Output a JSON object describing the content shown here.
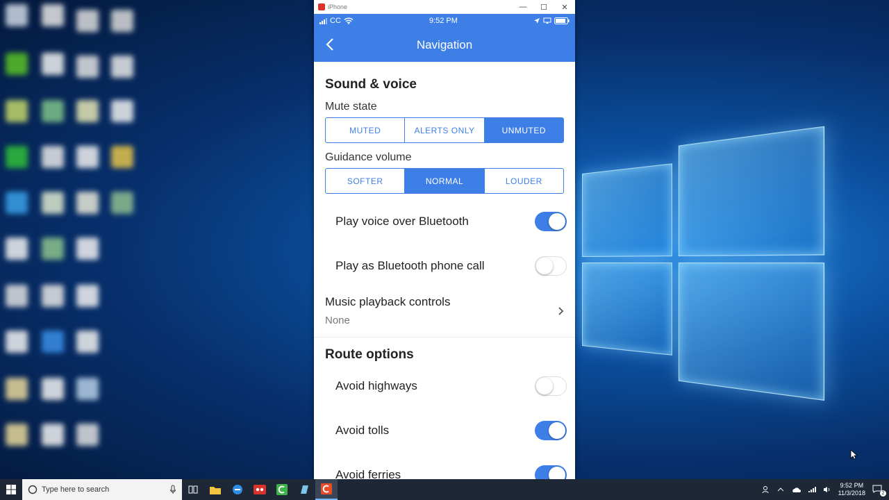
{
  "window": {
    "title": "iPhone",
    "minimize": "—",
    "maximize": "☐",
    "close": "✕"
  },
  "status": {
    "carrier": "CC",
    "time": "9:52 PM"
  },
  "appbar": {
    "title": "Navigation"
  },
  "sound": {
    "title": "Sound & voice",
    "mute_label": "Mute state",
    "mute_options": [
      "MUTED",
      "ALERTS ONLY",
      "UNMUTED"
    ],
    "mute_selected": "UNMUTED",
    "volume_label": "Guidance volume",
    "volume_options": [
      "SOFTER",
      "NORMAL",
      "LOUDER"
    ],
    "volume_selected": "NORMAL",
    "toggles": [
      {
        "label": "Play voice over Bluetooth",
        "on": true
      },
      {
        "label": "Play as Bluetooth phone call",
        "on": false
      }
    ],
    "music": {
      "label": "Music playback controls",
      "value": "None"
    }
  },
  "route": {
    "title": "Route options",
    "toggles": [
      {
        "label": "Avoid highways",
        "on": false
      },
      {
        "label": "Avoid tolls",
        "on": true
      },
      {
        "label": "Avoid ferries",
        "on": true
      }
    ]
  },
  "taskbar": {
    "search_placeholder": "Type here to search",
    "time": "9:52 PM",
    "date": "11/3/2018",
    "notifications": "2"
  },
  "colors": {
    "accent": "#3d7fe6"
  }
}
